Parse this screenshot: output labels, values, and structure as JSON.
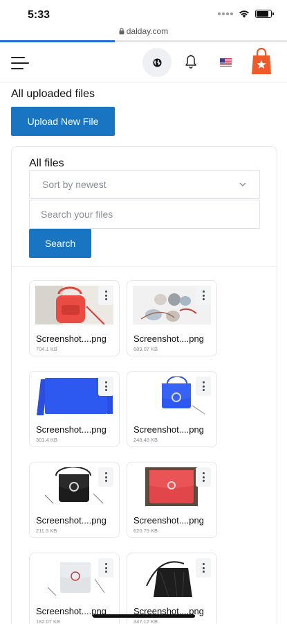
{
  "status": {
    "time": "5:33"
  },
  "browser": {
    "url": "dalday.com",
    "load_progress": 0.4
  },
  "header": {
    "menu_icon": "hamburger-menu-icon",
    "globe_icon": "globe-icon",
    "bell_icon": "bell-icon",
    "flag_icon": "us-flag-icon",
    "cart_icon": "shopping-bag-icon"
  },
  "page": {
    "title": "All uploaded files",
    "upload_label": "Upload New File"
  },
  "files": {
    "title": "All files",
    "sort_value": "Sort by newest",
    "search_placeholder": "Search your files",
    "search_label": "Search",
    "items": [
      {
        "name": "Screenshot....png",
        "size": "704.1 KB"
      },
      {
        "name": "Screenshot....png",
        "size": "689.07 KB"
      },
      {
        "name": "Screenshot....png",
        "size": "301.4 KB"
      },
      {
        "name": "Screenshot....png",
        "size": "248.48 KB"
      },
      {
        "name": "Screenshot....png",
        "size": "211.3 KB"
      },
      {
        "name": "Screenshot....png",
        "size": "620.79 KB"
      },
      {
        "name": "Screenshot....png",
        "size": "182.07 KB"
      },
      {
        "name": "Screenshot....png",
        "size": "347.12 KB"
      }
    ]
  },
  "colors": {
    "primary": "#1975c2",
    "accent_orange": "#f05a28",
    "progress": "#1f6fd6"
  }
}
